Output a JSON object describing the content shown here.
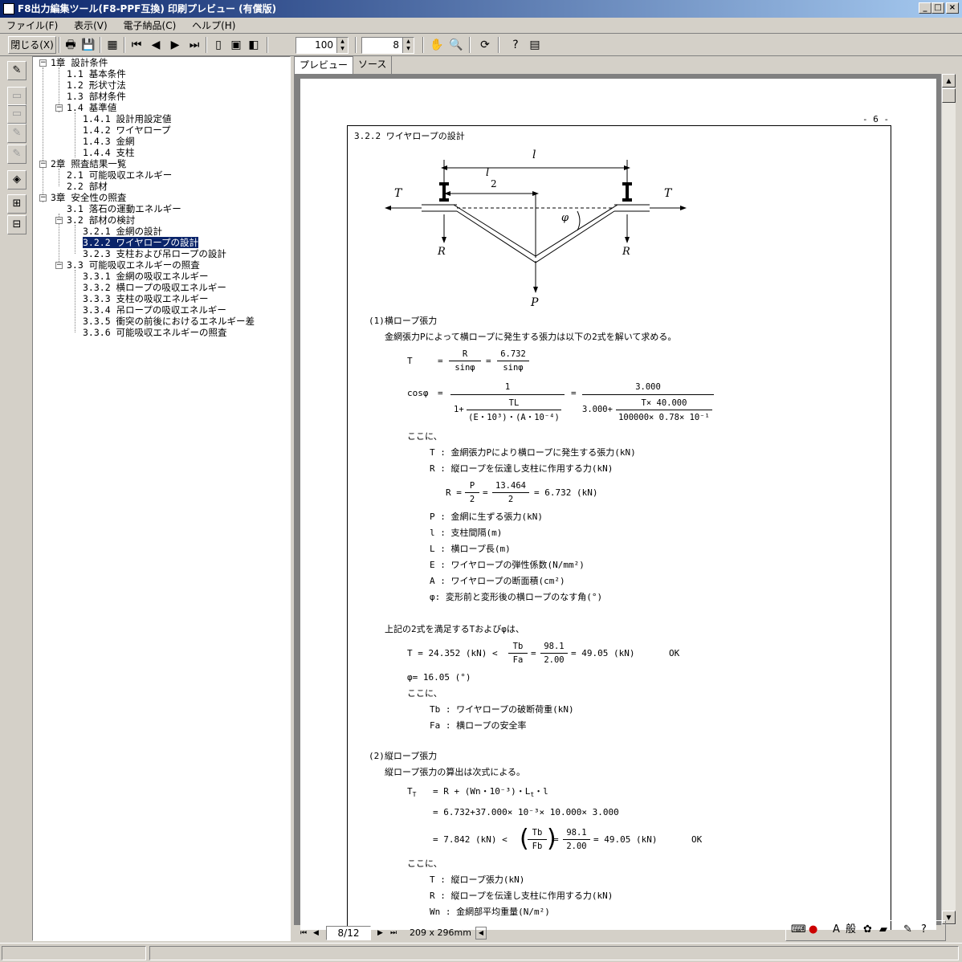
{
  "window": {
    "title": "F8出力編集ツール(F8-PPF互換) 印刷プレビュー (有償版)",
    "minimize": "_",
    "maximize": "□",
    "close": "×"
  },
  "menu": [
    "ファイル(F)",
    "表示(V)",
    "電子納品(C)",
    "ヘルプ(H)"
  ],
  "toolbar": {
    "close_label": "閉じる(X)",
    "zoom_value": "100",
    "font_size_value": "8"
  },
  "tree": {
    "nodes": [
      "1章 設計条件",
      "1.1 基本条件",
      "1.2 形状寸法",
      "1.3 部材条件",
      "1.4 基準値",
      "1.4.1 設計用設定値",
      "1.4.2 ワイヤロープ",
      "1.4.3 金網",
      "1.4.4 支柱",
      "2章 照査結果一覧",
      "2.1 可能吸収エネルギー",
      "2.2 部材",
      "3章 安全性の照査",
      "3.1 落石の運動エネルギー",
      "3.2 部材の検討",
      "3.2.1 金網の設計",
      "3.2.2 ワイヤロープの設計",
      "3.2.3 支柱および吊ロープの設計",
      "3.3 可能吸収エネルギーの照査",
      "3.3.1 金網の吸収エネルギー",
      "3.3.2 横ロープの吸収エネルギー",
      "3.3.3 支柱の吸収エネルギー",
      "3.3.4 吊ロープの吸収エネルギー",
      "3.3.5 衝突の前後におけるエネルギー差",
      "3.3.6 可能吸収エネルギーの照査"
    ],
    "selected": "3.2.2 ワイヤロープの設計"
  },
  "tabs": {
    "preview": "プレビュー",
    "source": "ソース"
  },
  "document": {
    "page_number": "- 6 -",
    "section_title": "3.2.2 ワイヤロープの設計",
    "diagram": {
      "l": "l",
      "l_half_num": "l",
      "l_half_den": "2",
      "T_left": "T",
      "T_right": "T",
      "phi": "φ",
      "R_left": "R",
      "R_right": "R",
      "P": "P"
    },
    "part1": {
      "heading": "(1)横ロープ張力",
      "intro": "金網張力Pによって横ロープに発生する張力は以下の2式を解いて求める。",
      "eq1_lhs": "T",
      "eq1_eq": "=",
      "eq1_f1_num": "R",
      "eq1_f1_den": "sinφ",
      "eq1_eq2": "=",
      "eq1_f2_num": "6.732",
      "eq1_f2_den": "sinφ",
      "eq2_lhs": "cosφ",
      "eq2_eq": "=",
      "eq2_num1": "1",
      "eq2_den1_prefix": "1+",
      "eq2_den1_num": "TL",
      "eq2_den1_den": "(E・10³)・(A・10⁻⁴)",
      "eq2_eq2": "=",
      "eq2_num2": "3.000",
      "eq2_den2_prefix": "3.000+",
      "eq2_den2_num": "T× 40.000",
      "eq2_den2_den": "100000× 0.78× 10⁻¹",
      "kokoni": "ここに、",
      "defs": [
        "T : 金網張力Pにより横ロープに発生する張力(kN)",
        "R : 縦ロープを伝達し支柱に作用する力(kN)"
      ],
      "R_eq_lhs": "R =",
      "R_f1_num": "P",
      "R_f1_den": "2",
      "R_eq2": "=",
      "R_f2_num": "13.464",
      "R_f2_den": "2",
      "R_result": "= 6.732 (kN)",
      "defs2": [
        "P : 金網に生ずる張力(kN)",
        "l : 支柱間隔(m)",
        "L : 横ロープ長(m)",
        "E : ワイヤロープの弾性係数(N/mm²)",
        "A : ワイヤロープの断面積(cm²)",
        "φ: 変形前と変形後の横ロープのなす角(°)"
      ],
      "satisfy": "上記の2式を満足するTおよびφは、",
      "T_result_lhs": "T = 24.352 (kN) <",
      "T_f1_num": "Tb",
      "T_f1_den": "Fa",
      "T_eq": "=",
      "T_f2_num": "98.1",
      "T_f2_den": "2.00",
      "T_result_rhs": "= 49.05 (kN)",
      "T_ok": "OK",
      "phi_result": "φ= 16.05 (°)",
      "kokoni2": "ここに、",
      "defs3": [
        "Tb : ワイヤロープの破断荷重(kN)",
        "Fa : 横ロープの安全率"
      ]
    },
    "part2": {
      "heading": "(2)縦ロープ張力",
      "intro": "縦ロープ張力の算出は次式による。",
      "Tt_lhs": "T",
      "Tt_sub": "T",
      "Tt_line1": "= R + (Wn・10⁻³)・L",
      "Tt_line1_sub": "t",
      "Tt_line1_tail": "・l",
      "Tt_line2": "= 6.732+37.000× 10⁻³× 10.000× 3.000",
      "Tt_line3_lhs": "= 7.842 (kN) <",
      "Tt_f1_num": "Tb",
      "Tt_f1_den": "Fb",
      "Tt_eq": "=",
      "Tt_f2_num": "98.1",
      "Tt_f2_den": "2.00",
      "Tt_result": "= 49.05 (kN)",
      "Tt_ok": "OK",
      "kokoni": "ここに、",
      "defs": [
        "T : 縦ロープ張力(kN)",
        "R : 縦ロープを伝達し支柱に作用する力(kN)",
        "Wn : 金網部平均重量(N/m²)"
      ],
      "defs_sub": "T"
    }
  },
  "navigation": {
    "page": "8/12",
    "paper_size": "209 x 296mm"
  },
  "ime": {
    "mode": "A",
    "dict": "般"
  }
}
